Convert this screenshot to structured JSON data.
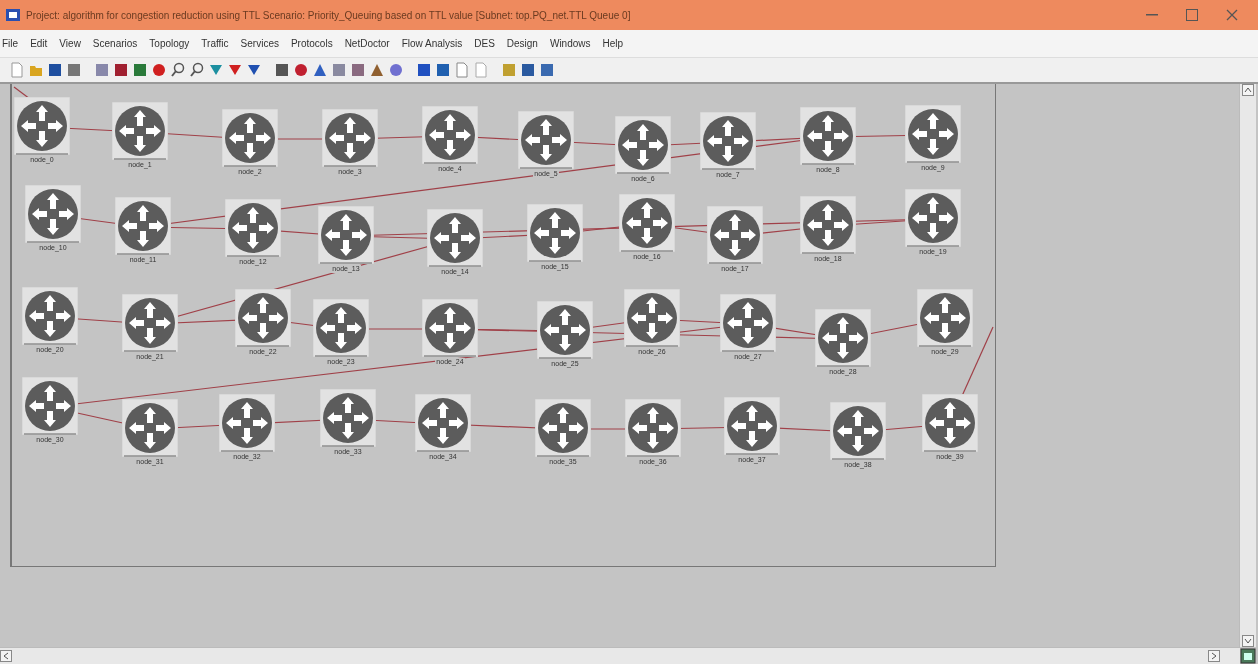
{
  "window": {
    "title": "Project: algorithm for congestion reduction using TTL Scenario: Priority_Queuing based on  TTL value  [Subnet: top.PQ_net.TTL Queue 0]"
  },
  "menu": [
    "File",
    "Edit",
    "View",
    "Scenarios",
    "Topology",
    "Traffic",
    "Services",
    "Protocols",
    "NetDoctor",
    "Flow Analysis",
    "DES",
    "Design",
    "Windows",
    "Help"
  ],
  "nodes": [
    {
      "label": "node_0"
    },
    {
      "label": "node_1"
    },
    {
      "label": "node_2"
    },
    {
      "label": "node_3"
    },
    {
      "label": "node_4"
    },
    {
      "label": "node_5"
    },
    {
      "label": "node_6"
    },
    {
      "label": "node_7"
    },
    {
      "label": "node_8"
    },
    {
      "label": "node_9"
    },
    {
      "label": "node_10"
    },
    {
      "label": "node_11"
    },
    {
      "label": "node_12"
    },
    {
      "label": "node_13"
    },
    {
      "label": "node_14"
    },
    {
      "label": "node_15"
    },
    {
      "label": "node_16"
    },
    {
      "label": "node_17"
    },
    {
      "label": "node_18"
    },
    {
      "label": "node_19"
    },
    {
      "label": "node_20"
    },
    {
      "label": "node_21"
    },
    {
      "label": "node_22"
    },
    {
      "label": "node_23"
    },
    {
      "label": "node_24"
    },
    {
      "label": "node_25"
    },
    {
      "label": "node_26"
    },
    {
      "label": "node_27"
    },
    {
      "label": "node_28"
    },
    {
      "label": "node_29"
    },
    {
      "label": "node_30"
    },
    {
      "label": "node_31"
    },
    {
      "label": "node_32"
    },
    {
      "label": "node_33"
    },
    {
      "label": "node_34"
    },
    {
      "label": "node_35"
    },
    {
      "label": "node_36"
    },
    {
      "label": "node_37"
    },
    {
      "label": "node_38"
    },
    {
      "label": "node_39"
    }
  ]
}
